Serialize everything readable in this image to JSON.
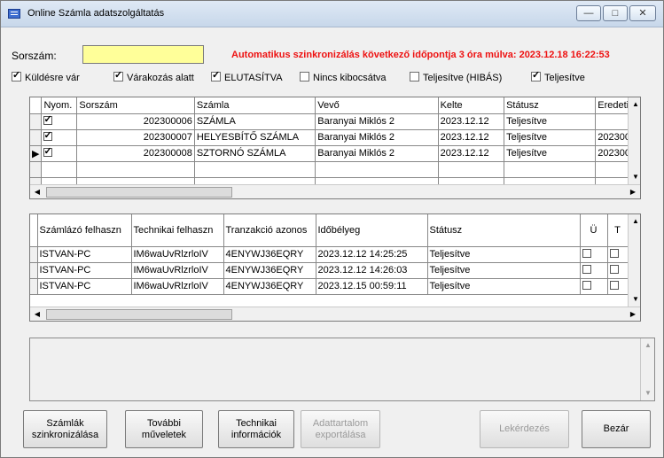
{
  "window": {
    "title": "Online Számla adatszolgáltatás",
    "min_glyph": "—",
    "max_glyph": "□",
    "close_glyph": "✕"
  },
  "header": {
    "sorszam_label": "Sorszám:",
    "sorszam_value": "",
    "sync_notice": "Automatikus szinkronizálás következő időpontja 3 óra múlva: 2023.12.18 16:22:53"
  },
  "filters": [
    {
      "label": "Küldésre vár",
      "checked": true
    },
    {
      "label": "Várakozás alatt",
      "checked": true
    },
    {
      "label": "ELUTASÍTVA",
      "checked": true
    },
    {
      "label": "Nincs kibocsátva",
      "checked": false
    },
    {
      "label": "Teljesítve (HIBÁS)",
      "checked": false
    },
    {
      "label": "Teljesítve",
      "checked": true
    }
  ],
  "invoices": {
    "columns": [
      "Nyom.",
      "Sorszám",
      "Számla",
      "Vevő",
      "Kelte",
      "Státusz",
      "Eredeti"
    ],
    "rows": [
      {
        "nyom": true,
        "sorszam": "202300006",
        "szamla": "SZÁMLA",
        "vevo": "Baranyai Miklós 2",
        "kelte": "2023.12.12",
        "statusz": "Teljesítve",
        "eredeti": ""
      },
      {
        "nyom": true,
        "sorszam": "202300007",
        "szamla": "HELYESBÍTŐ SZÁMLA",
        "vevo": "Baranyai Miklós 2",
        "kelte": "2023.12.12",
        "statusz": "Teljesítve",
        "eredeti": "202300"
      },
      {
        "nyom": true,
        "sorszam": "202300008",
        "szamla": "SZTORNÓ SZÁMLA",
        "vevo": "Baranyai Miklós 2",
        "kelte": "2023.12.12",
        "statusz": "Teljesítve",
        "eredeti": "202300"
      }
    ],
    "current_row_glyph": "▶"
  },
  "transactions": {
    "columns": [
      "Számlázó felhaszn",
      "Technikai felhaszn",
      "Tranzakció azonos",
      "Időbélyeg",
      "Státusz",
      "Ü",
      "T"
    ],
    "rows": [
      {
        "szamlazo": "ISTVAN-PC",
        "technikai": "IM6waUvRlzrloIV",
        "tranzakcio": "4ENYWJ36EQRY",
        "idobelyeg": "2023.12.12 14:25:25",
        "statusz": "Teljesítve"
      },
      {
        "szamlazo": "ISTVAN-PC",
        "technikai": "IM6waUvRlzrloIV",
        "tranzakcio": "4ENYWJ36EQRY",
        "idobelyeg": "2023.12.12 14:26:03",
        "statusz": "Teljesítve"
      },
      {
        "szamlazo": "ISTVAN-PC",
        "technikai": "IM6waUvRlzrloIV",
        "tranzakcio": "4ENYWJ36EQRY",
        "idobelyeg": "2023.12.15 00:59:11",
        "statusz": "Teljesítve"
      }
    ]
  },
  "scroll": {
    "up": "▲",
    "down": "▼",
    "left": "◀",
    "right": "▶"
  },
  "buttons": {
    "sync": "Számlák szinkronizálása",
    "more_ops": "További műveletek",
    "tech_info": "Technikai információk",
    "export": "Adattartalom exportálása",
    "query": "Lekérdezés",
    "close": "Bezár"
  }
}
